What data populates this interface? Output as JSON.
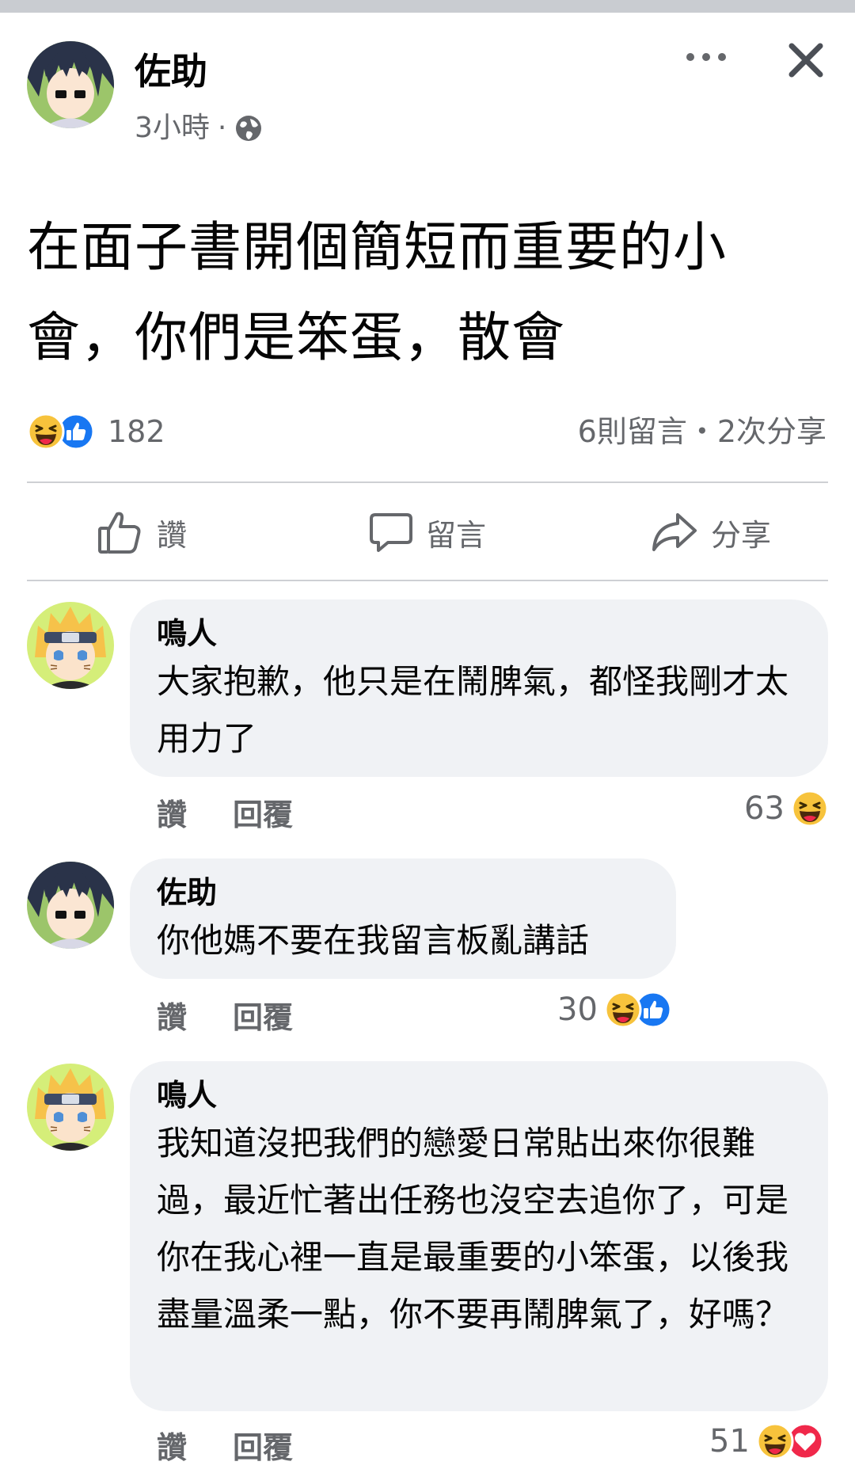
{
  "post": {
    "author": "佐助",
    "time": "3小時",
    "separator": "·",
    "text": "在面子書開個簡短而重要的小會，你們是笨蛋，散會",
    "reaction_count": "182",
    "stats": "6則留言・2次分享"
  },
  "actions": {
    "like": "讚",
    "comment": "留言",
    "share": "分享"
  },
  "comments": [
    {
      "author": "鳴人",
      "text": "大家抱歉，他只是在鬧脾氣，都怪我剛才太用力了",
      "like": "讚",
      "reply": "回覆",
      "reaction_count": "63"
    },
    {
      "author": "佐助",
      "text": "你他媽不要在我留言板亂講話",
      "like": "讚",
      "reply": "回覆",
      "reaction_count": "30"
    },
    {
      "author": "鳴人",
      "text": "我知道沒把我們的戀愛日常貼出來你很難過，最近忙著出任務也沒空去追你了，可是你在我心裡一直是最重要的小笨蛋，以後我盡量溫柔一點，你不要再鬧脾氣了，好嗎？",
      "like": "讚",
      "reply": "回覆",
      "reaction_count": "51"
    }
  ],
  "colors": {
    "text": "#050505",
    "secondary": "#65676b",
    "bubble": "#f0f2f5",
    "like_blue": "#1877f2",
    "haha_yellow": "#f7c33c",
    "love_red": "#f0284a"
  }
}
